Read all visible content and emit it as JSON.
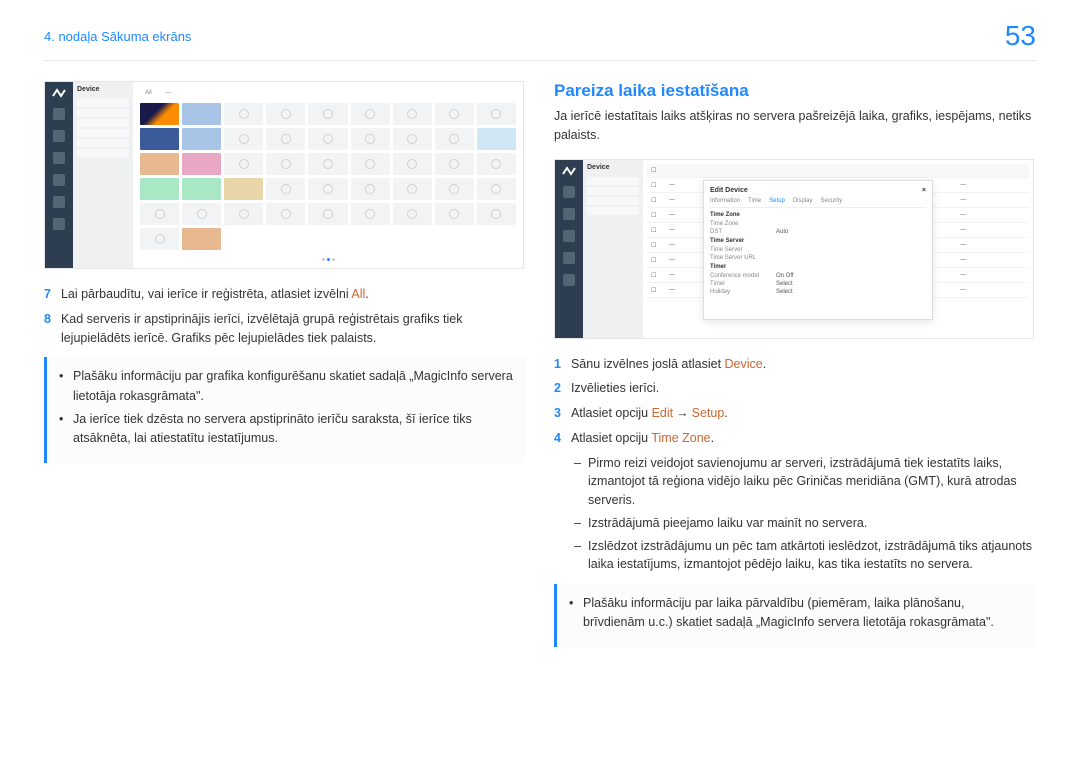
{
  "header": {
    "chapter": "4. nodaļa Sākuma ekrāns",
    "page": "53"
  },
  "left": {
    "screenshot": {
      "panel_title": "Device"
    },
    "steps": [
      {
        "n": "7",
        "pre": "Lai pārbaudītu, vai ierīce ir reģistrēta, atlasiet izvēlni ",
        "hl": "All",
        "post": "."
      },
      {
        "n": "8",
        "pre": "Kad serveris ir apstiprinājis ierīci, izvēlētajā grupā reģistrētais grafiks tiek lejupielādēts ierīcē. Grafiks pēc lejupielādes tiek palaists.",
        "hl": "",
        "post": ""
      }
    ],
    "note": [
      "Plašāku informāciju par grafika konfigurēšanu skatiet sadaļā „MagicInfo servera lietotāja rokasgrāmata\".",
      "Ja ierīce tiek dzēsta no servera apstiprināto ierīču saraksta, šī ierīce tiks atsāknēta, lai atiestatītu iestatījumus."
    ]
  },
  "right": {
    "title": "Pareiza laika iestatīšana",
    "intro": "Ja ierīcē iestatītais laiks atšķiras no servera pašreizējā laika, grafiks, iespējams, netiks palaists.",
    "screenshot": {
      "panel_title": "Device",
      "modal_title": "Edit Device",
      "tabs": [
        "Information",
        "Time",
        "Setup",
        "Display",
        "Security"
      ],
      "sections": {
        "tz": "Time Zone",
        "fields": [
          {
            "label": "Time Zone",
            "value": ""
          },
          {
            "label": "DST",
            "value": "Auto"
          }
        ],
        "ts": "Time Server",
        "fields2": [
          {
            "label": "Time Server",
            "value": ""
          },
          {
            "label": "Time Server URL",
            "value": ""
          }
        ],
        "tm": "Timer",
        "fields3": [
          {
            "label": "Conference model",
            "value": "On  Off"
          },
          {
            "label": "Timer",
            "value": "Select"
          },
          {
            "label": "Holiday",
            "value": "Select"
          }
        ]
      }
    },
    "steps": {
      "s1_pre": "Sānu izvēlnes joslā atlasiet ",
      "s1_hl": "Device",
      "s1_post": ".",
      "s2": "Izvēlieties ierīci.",
      "s3_pre": "Atlasiet opciju ",
      "s3_hl1": "Edit",
      "s3_arrow": "→",
      "s3_hl2": "Setup",
      "s3_post": ".",
      "s4_pre": "Atlasiet opciju ",
      "s4_hl": "Time Zone",
      "s4_post": "."
    },
    "sub": [
      "Pirmo reizi veidojot savienojumu ar serveri, izstrādājumā tiek iestatīts laiks, izmantojot tā reģiona vidējo laiku pēc Griničas meridiāna (GMT), kurā atrodas serveris.",
      "Izstrādājumā pieejamo laiku var mainīt no servera.",
      "Izslēdzot izstrādājumu un pēc tam atkārtoti ieslēdzot, izstrādājumā tiks atjaunots laika iestatījums, izmantojot pēdējo laiku, kas tika iestatīts no servera."
    ],
    "note": [
      "Plašāku informāciju par laika pārvaldību (piemēram, laika plānošanu, brīvdienām u.c.) skatiet sadaļā „MagicInfo servera lietotāja rokasgrāmata\"."
    ]
  }
}
